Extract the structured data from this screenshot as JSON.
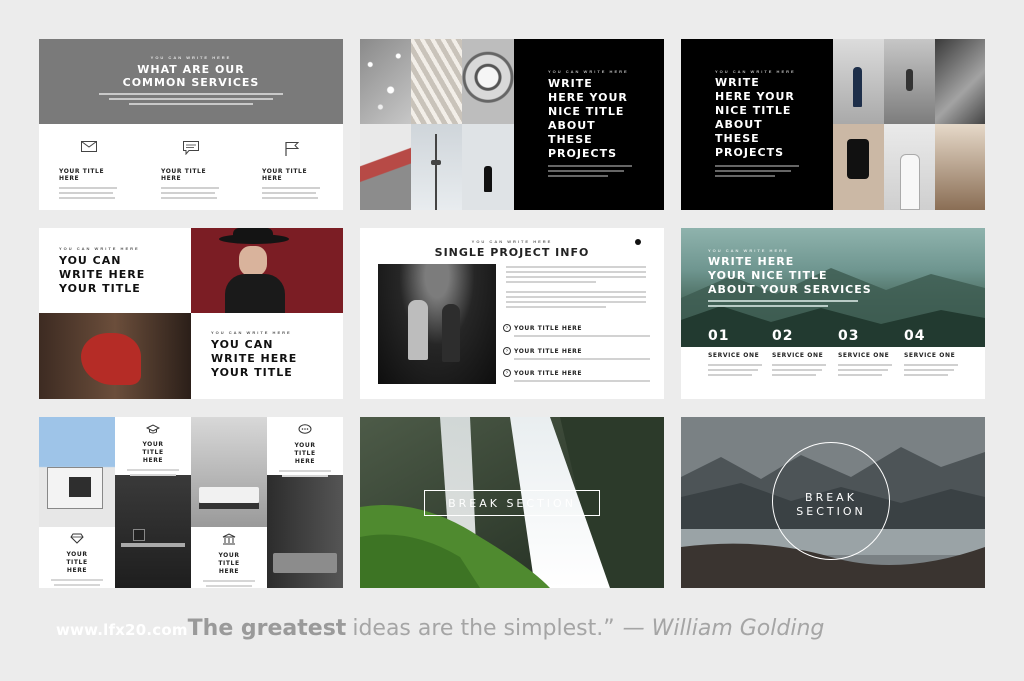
{
  "slides": {
    "s1": {
      "kicker": "YOU CAN WRITE HERE",
      "title_line1": "WHAT ARE OUR",
      "title_line2": "COMMON SERVICES",
      "services": [
        {
          "icon": "envelope-icon",
          "label": "YOUR TITLE HERE"
        },
        {
          "icon": "message-icon",
          "label": "YOUR TITLE HERE"
        },
        {
          "icon": "flag-icon",
          "label": "YOUR TITLE HERE"
        }
      ]
    },
    "s2": {
      "kicker": "YOU CAN WRITE HERE",
      "title_lines": [
        "WRITE",
        "HERE YOUR",
        "NICE TITLE",
        "ABOUT",
        "THESE",
        "PROJECTS"
      ]
    },
    "s3": {
      "kicker": "YOU CAN WRITE HERE",
      "title_lines": [
        "WRITE",
        "HERE YOUR",
        "NICE TITLE",
        "ABOUT",
        "THESE",
        "PROJECTS"
      ]
    },
    "s4": {
      "kicker_top": "YOU CAN WRITE HERE",
      "title_top": [
        "YOU CAN",
        "WRITE HERE",
        "YOUR TITLE"
      ],
      "kicker_bottom": "YOU CAN WRITE HERE",
      "title_bottom": [
        "YOU CAN",
        "WRITE HERE",
        "YOUR TITLE"
      ]
    },
    "s5": {
      "kicker": "YOU CAN WRITE HERE",
      "title": "SINGLE PROJECT INFO",
      "items": [
        "YOUR TITLE HERE",
        "YOUR TITLE HERE",
        "YOUR TITLE HERE"
      ]
    },
    "s6": {
      "kicker": "YOU CAN WRITE HERE",
      "title_lines": [
        "WRITE HERE",
        "YOUR NICE TITLE",
        "ABOUT YOUR SERVICES"
      ],
      "steps": [
        {
          "num": "01",
          "label": "SERVICE ONE"
        },
        {
          "num": "02",
          "label": "SERVICE ONE"
        },
        {
          "num": "03",
          "label": "SERVICE ONE"
        },
        {
          "num": "04",
          "label": "SERVICE ONE"
        }
      ]
    },
    "s7": {
      "cards": [
        {
          "icon": "graduation-cap-icon",
          "label": "YOUR TITLE HERE"
        },
        {
          "icon": "chat-bubble-icon",
          "label": "YOUR TITLE HERE"
        },
        {
          "icon": "diamond-icon",
          "label": "YOUR TITLE HERE"
        },
        {
          "icon": "bank-icon",
          "label": "YOUR TITLE HERE"
        }
      ]
    },
    "s8": {
      "label": "BREAK SECTION"
    },
    "s9": {
      "line1": "BREAK",
      "line2": "SECTION"
    }
  },
  "footer": {
    "watermark": "www.lfx20.com",
    "quote_strong": "The greatest",
    "quote_rest": "ideas are the simplest.”",
    "author": "— William Golding"
  }
}
